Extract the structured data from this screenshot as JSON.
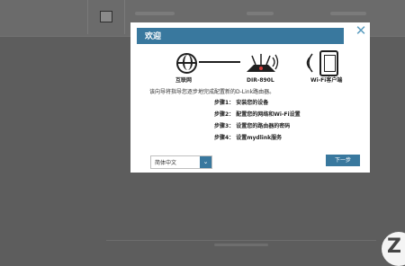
{
  "dialog": {
    "title": "欢迎",
    "labels": {
      "internet": "互联网",
      "router": "DIR-890L",
      "client": "Wi-Fi客户端"
    },
    "intro": "该向导将指导您逐步地完成配置新的D-Link路由器。",
    "steps": [
      "步骤1：  安装您的设备",
      "步骤2：  配置您的网络和Wi-Fi设置",
      "步骤3：  设置您的路由器的密码",
      "步骤4：  设置mydlink服务"
    ],
    "language": "简体中文",
    "next_label": "下一步"
  },
  "icons": [
    "globe-icon",
    "router-icon",
    "wifi-icon",
    "device-icon",
    "close-icon",
    "chevron-down-icon"
  ],
  "colors": {
    "accent": "#39789e",
    "overlay": "#5d5d5d"
  }
}
